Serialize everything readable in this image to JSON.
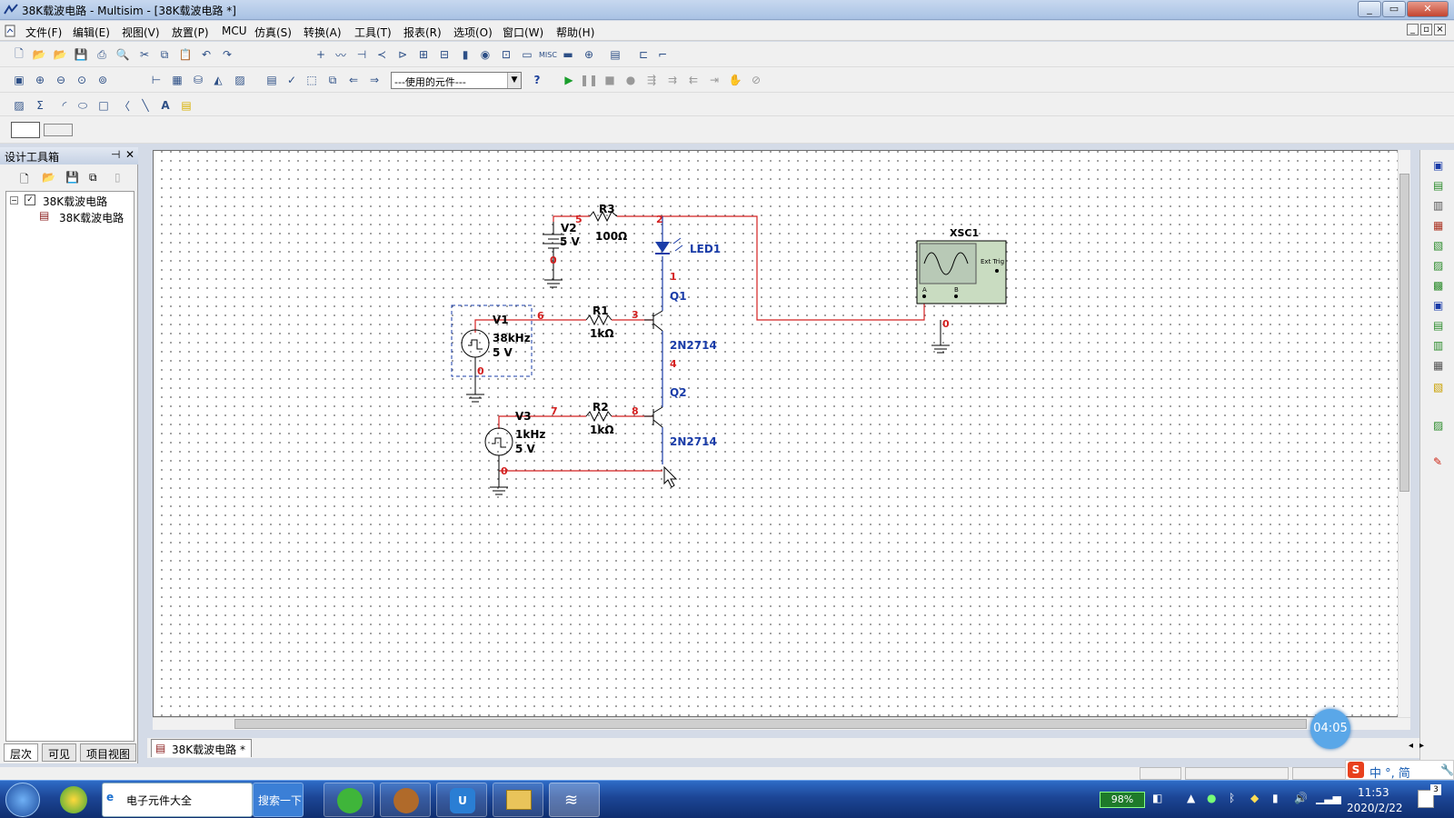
{
  "window": {
    "title": "38K载波电路 - Multisim - [38K载波电路 *]"
  },
  "menu": [
    "文件(F)",
    "编辑(E)",
    "视图(V)",
    "放置(P)",
    "MCU",
    "仿真(S)",
    "转换(A)",
    "工具(T)",
    "报表(R)",
    "选项(O)",
    "窗口(W)",
    "帮助(H)"
  ],
  "toolbar": {
    "inuse_dropdown": "---使用的元件---"
  },
  "design_toolbox": {
    "title": "设计工具箱",
    "tree_root": "38K载波电路",
    "tree_child": "38K载波电路",
    "tabs": [
      "层次",
      "可见",
      "项目视图"
    ]
  },
  "schematic": {
    "V2": {
      "name": "V2",
      "value": "5 V"
    },
    "R3": {
      "name": "R3",
      "value": "100Ω"
    },
    "LED1": "LED1",
    "Q1": {
      "name": "Q1",
      "model": "2N2714"
    },
    "Q2": {
      "name": "Q2",
      "model": "2N2714"
    },
    "V1": {
      "name": "V1",
      "freq": "38kHz",
      "value": "5 V"
    },
    "R1": {
      "name": "R1",
      "value": "1kΩ"
    },
    "V3": {
      "name": "V3",
      "freq": "1kHz",
      "value": "5 V"
    },
    "R2": {
      "name": "R2",
      "value": "1kΩ"
    },
    "XSC1": "XSC1",
    "nets": [
      "5",
      "2",
      "1",
      "0",
      "6",
      "3",
      "4",
      "7",
      "8",
      "0",
      "0",
      "0"
    ],
    "scope_labels": {
      "ext": "Ext Trig",
      "a": "A",
      "b": "B"
    }
  },
  "doc_tab": "38K载波电路 *",
  "timer": "04:05",
  "taskbar": {
    "ie_label": "电子元件大全",
    "search_label": "搜索一下",
    "battery": "98%",
    "time": "11:53",
    "date": "2020/2/22",
    "ime": "中 °, 简",
    "badge": "3"
  }
}
